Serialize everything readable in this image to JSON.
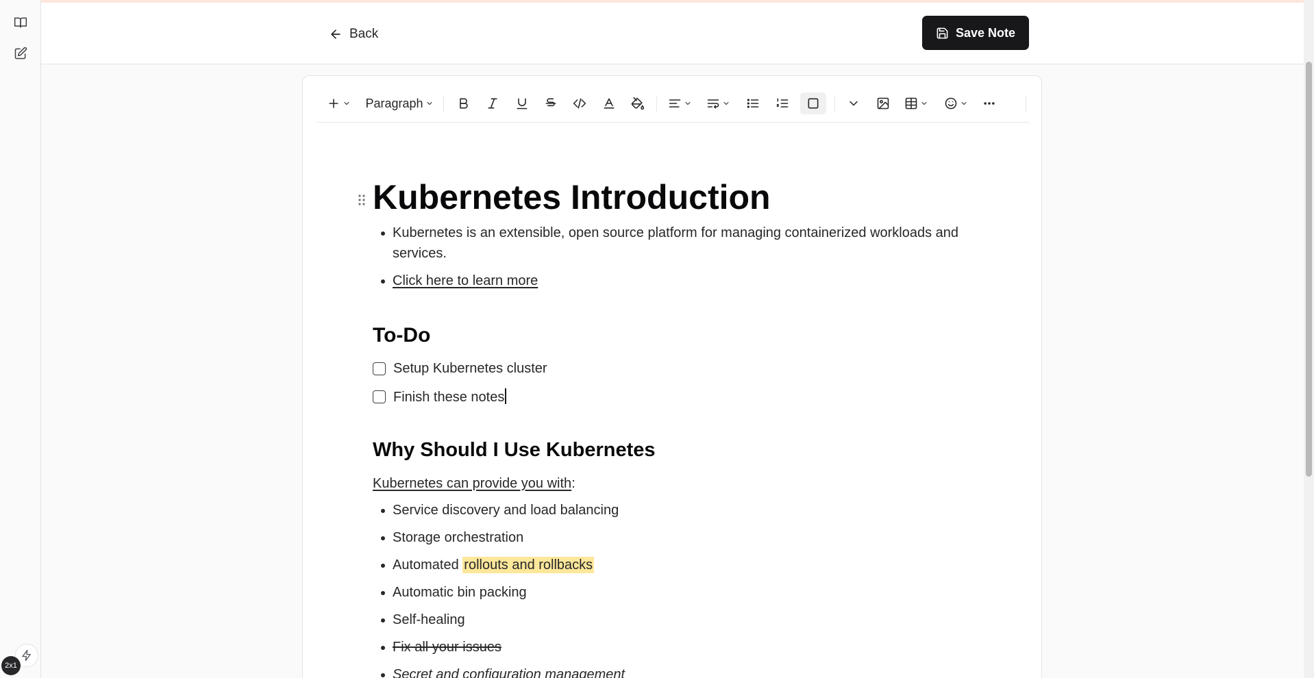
{
  "header": {
    "back_label": "Back",
    "save_label": "Save Note"
  },
  "toolbar": {
    "block_type": "Paragraph",
    "icons": [
      "plus-icon",
      "bold-icon",
      "italic-icon",
      "underline-icon",
      "strikethrough-icon",
      "code-icon",
      "text-color-icon",
      "highlight-icon",
      "align-icon",
      "line-height-icon",
      "bullet-list-icon",
      "numbered-list-icon",
      "checkbox-icon",
      "chevron-down-icon",
      "image-icon",
      "table-icon",
      "emoji-icon",
      "more-icon"
    ]
  },
  "document": {
    "title": "Kubernetes Introduction",
    "intro_bullets": [
      "Kubernetes is an extensible, open source platform for managing containerized workloads and services.",
      "Click here to learn more"
    ],
    "todo_heading": "To-Do",
    "todos": [
      {
        "label": "Setup Kubernetes cluster",
        "checked": false
      },
      {
        "label": "Finish these notes",
        "checked": false
      }
    ],
    "why_heading": "Why Should I Use Kubernetes",
    "why_intro": "Kubernetes can provide you with",
    "why_intro_suffix": ":",
    "features": {
      "f1": "Service discovery and load balancing",
      "f2": "Storage orchestration",
      "f3_prefix": "Automated ",
      "f3_highlight": "rollouts and rollbacks",
      "f4": "Automatic bin packing",
      "f5": "Self-healing",
      "f6": "Fix all your issues",
      "f7": "Secret and configuration management"
    }
  },
  "footer": {
    "badge": "2x1"
  },
  "colors": {
    "accent_dark": "#18181b",
    "highlight": "#fde79a",
    "top_strip": "#fde7dc"
  }
}
